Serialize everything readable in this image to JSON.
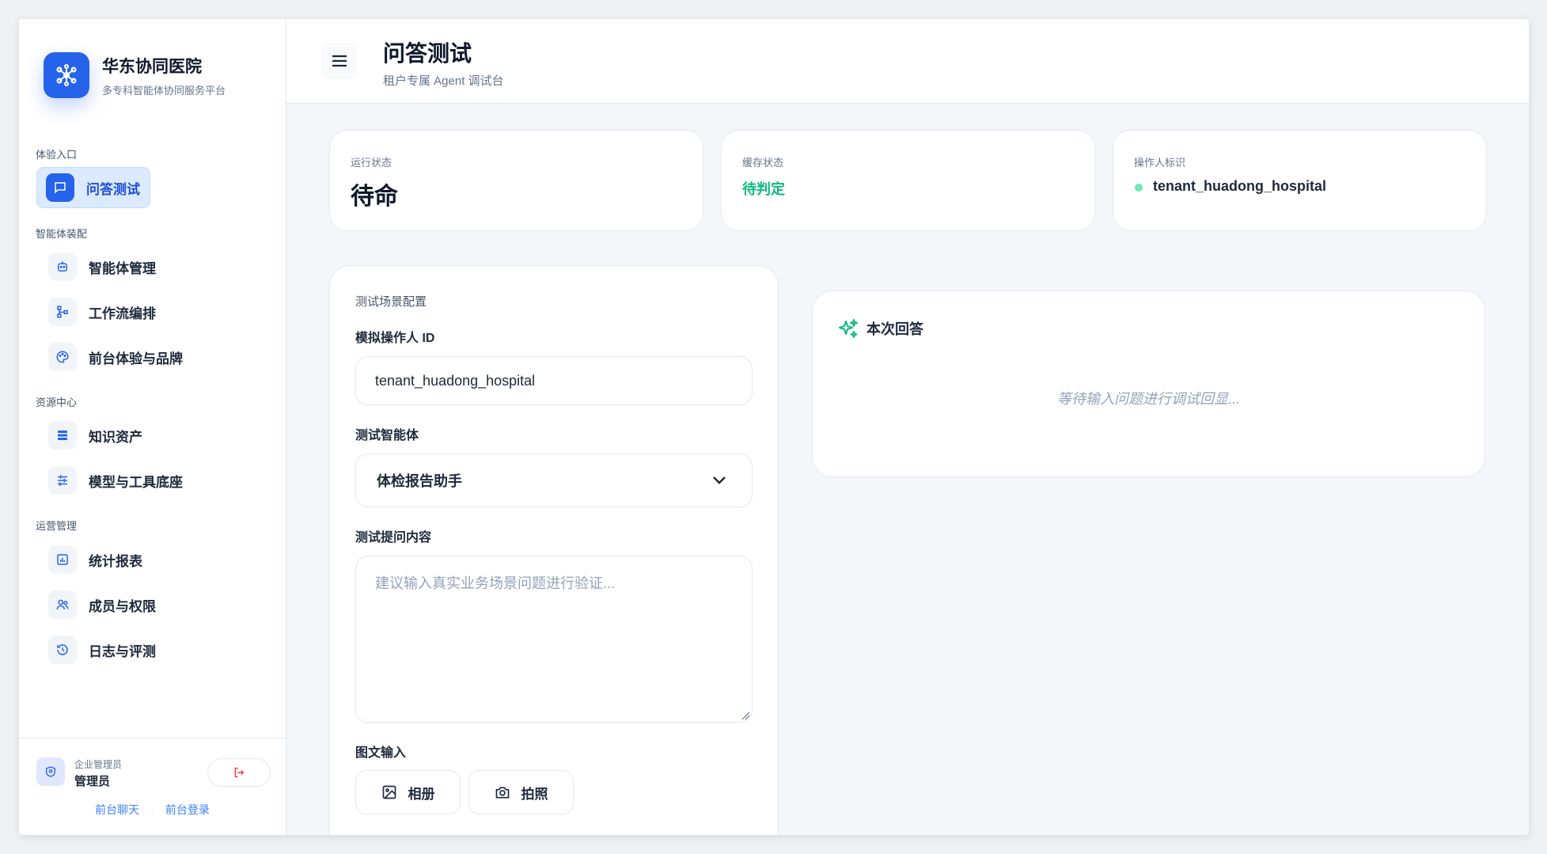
{
  "brand": {
    "name": "华东协同医院",
    "subtitle": "多专科智能体协同服务平台"
  },
  "sidebar": {
    "sections": [
      "体验入口",
      "智能体装配",
      "资源中心",
      "运营管理"
    ],
    "items": [
      {
        "label": "问答测试",
        "icon": "chat-icon",
        "active": true
      },
      {
        "label": "智能体管理",
        "icon": "robot-icon"
      },
      {
        "label": "工作流编排",
        "icon": "workflow-icon"
      },
      {
        "label": "前台体验与品牌",
        "icon": "palette-icon"
      },
      {
        "label": "知识资产",
        "icon": "list-icon"
      },
      {
        "label": "模型与工具底座",
        "icon": "sliders-icon"
      },
      {
        "label": "统计报表",
        "icon": "chart-icon"
      },
      {
        "label": "成员与权限",
        "icon": "users-icon"
      },
      {
        "label": "日志与评测",
        "icon": "history-icon"
      }
    ],
    "footer": {
      "role": "企业管理员",
      "name": "管理员",
      "links": [
        "前台聊天",
        "前台登录"
      ]
    }
  },
  "header": {
    "title": "问答测试",
    "subtitle": "租户专属 Agent 调试台"
  },
  "stats": [
    {
      "label": "运行状态",
      "value": "待命"
    },
    {
      "label": "缓存状态",
      "value": "待判定"
    },
    {
      "label": "操作人标识",
      "value": "tenant_huadong_hospital"
    }
  ],
  "config": {
    "title": "测试场景配置",
    "operator_label": "模拟操作人 ID",
    "operator_value": "tenant_huadong_hospital",
    "agent_label": "测试智能体",
    "agent_value": "体检报告助手",
    "prompt_label": "测试提问内容",
    "prompt_placeholder": "建议输入真实业务场景问题进行验证...",
    "image_label": "图文输入",
    "album_button": "相册",
    "camera_button": "拍照"
  },
  "answer": {
    "title": "本次回答",
    "placeholder": "等待输入问题进行调试回显..."
  },
  "colors": {
    "accent": "#2563eb",
    "success": "#10b981",
    "danger": "#ef4444"
  }
}
